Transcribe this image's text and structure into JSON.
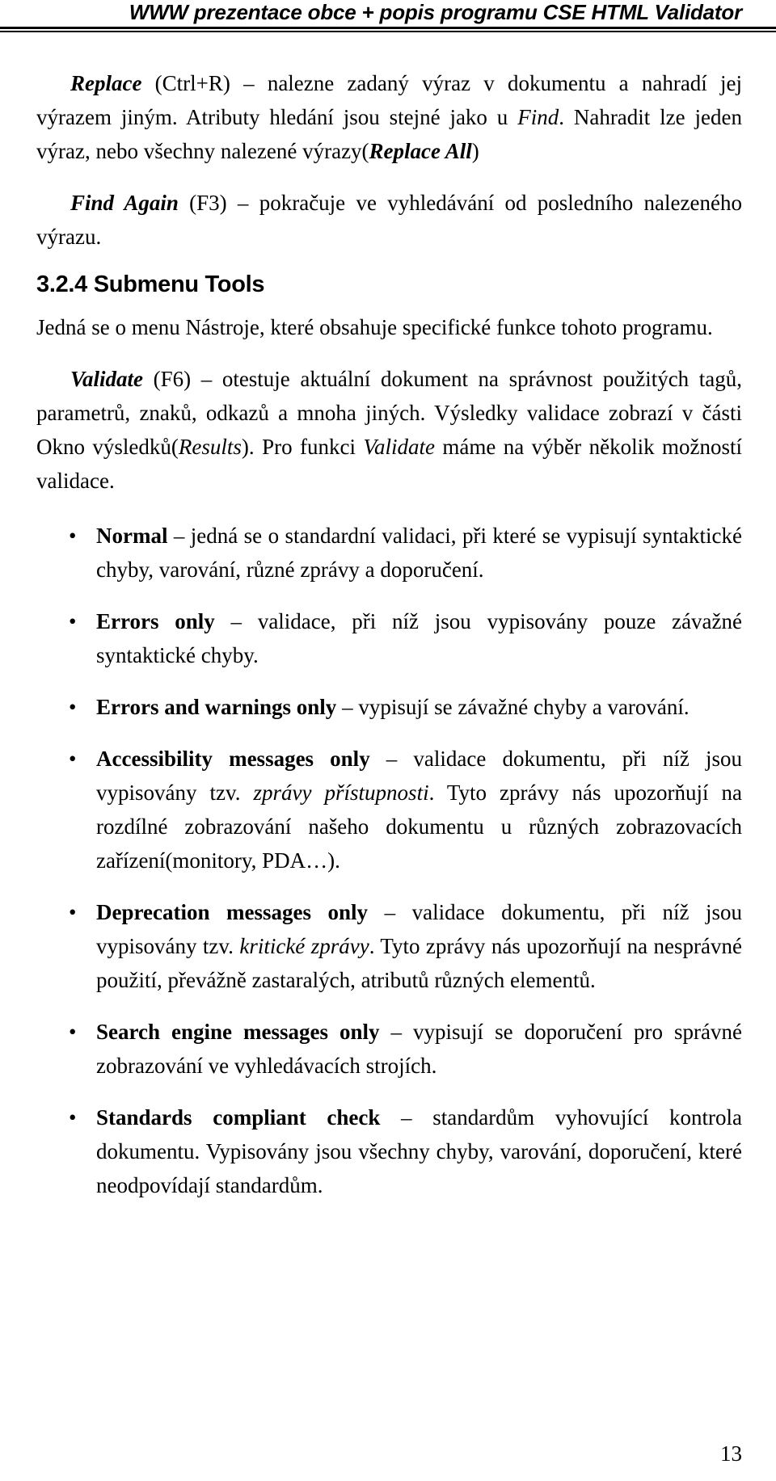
{
  "document": {
    "language": "cs",
    "running_header": "WWW prezentace obce + popis programu CSE HTML Validator",
    "page_number": "13"
  },
  "body": {
    "paragraph_replace": {
      "term": "Replace",
      "shortcut": "(Ctrl+R)",
      "text_part1": " – nalezne zadaný výraz v dokumentu a nahradí jej výrazem jiným. Atributy hledání jsou stejné jako u ",
      "ref_find": "Find",
      "text_part2": ". Nahradit lze jeden výraz, nebo všechny nalezené výrazy(",
      "ref_replace_all": "Replace All",
      "text_part3": ")"
    },
    "paragraph_find_again": {
      "term": "Find Again",
      "shortcut": "(F3)",
      "text": " – pokračuje ve vyhledávání od posledního nalezeného výrazu."
    },
    "heading": "3.2.4 Submenu Tools",
    "paragraph_intro": "Jedná se o menu Nástroje, které obsahuje specifické funkce tohoto programu.",
    "paragraph_validate": {
      "term": "Validate",
      "shortcut": "(F6)",
      "text_part1": " – otestuje aktuální dokument na správnost použitých tagů, parametrů, znaků, odkazů a mnoha jiných. Výsledky validace zobrazí v části Okno výsledků(",
      "ref_results": "Results",
      "text_part2": "). Pro funkci ",
      "ref_validate": "Validate",
      "text_part3": " máme na výběr několik možností validace."
    },
    "bullet_glyph": "•",
    "bullets": [
      {
        "name": "normal",
        "term": "Normal",
        "text": " – jedná se o standardní validaci, při které se vypisují syntaktické chyby, varování, různé zprávy a doporučení."
      },
      {
        "name": "errors-only",
        "term": "Errors only",
        "text": " – validace, při níž jsou vypisovány pouze závažné syntaktické chyby."
      },
      {
        "name": "errors-and-warnings-only",
        "term": "Errors and warnings only",
        "text": " – vypisují se závažné chyby a varování."
      },
      {
        "name": "accessibility-messages-only",
        "term": "Accessibility messages only",
        "text_part1": " – validace dokumentu, při níž jsou vypisovány tzv. ",
        "emphasis": "zprávy přístupnosti",
        "text_part2": ". Tyto zprávy nás upozorňují na rozdílné zobrazování našeho dokumentu u různých zobrazovacích zařízení(monitory, PDA…)."
      },
      {
        "name": "deprecation-messages-only",
        "term": "Deprecation messages only",
        "text_part1": " – validace dokumentu, při níž jsou vypisovány tzv. ",
        "emphasis": "kritické zprávy",
        "text_part2": ". Tyto zprávy nás upozorňují na nesprávné použití, převážně zastaralých, atributů různých elementů."
      },
      {
        "name": "search-engine-messages-only",
        "term": "Search engine messages only",
        "text": " – vypisují se doporučení pro správné zobrazování ve vyhledávacích strojích."
      },
      {
        "name": "standards-compliant-check",
        "term": "Standards compliant check",
        "text": " – standardům vyhovující kontrola dokumentu. Vypisovány jsou všechny chyby,  varování, doporučení, které neodpovídají standardům."
      }
    ]
  },
  "colors": {
    "text": "#000000",
    "background": "#ffffff",
    "rule": "#000000"
  }
}
